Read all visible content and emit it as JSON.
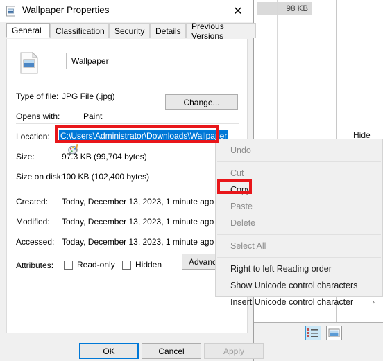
{
  "explorer": {
    "size_cell_value": "98 KB",
    "hide_label": "Hide",
    "view_details_icon": "details-view-icon",
    "view_icons_icon": "large-icons-view-icon"
  },
  "dialog": {
    "title": "Wallpaper Properties",
    "title_icon": "image-file-icon",
    "close_icon": "✕",
    "tabs": [
      {
        "label": "General",
        "active": true
      },
      {
        "label": "Classification",
        "active": false
      },
      {
        "label": "Security",
        "active": false
      },
      {
        "label": "Details",
        "active": false
      },
      {
        "label": "Previous Versions",
        "active": false
      }
    ],
    "file_icon": "image-document-icon",
    "name_value": "Wallpaper",
    "fields": {
      "type_label": "Type of file:",
      "type_value": "JPG File (.jpg)",
      "opens_label": "Opens with:",
      "opens_value": "Paint",
      "opens_icon": "paint-palette-icon",
      "change_button": "Change...",
      "location_label": "Location:",
      "location_value": "C:\\Users\\Administrator\\Downloads\\Wallpaper",
      "size_label": "Size:",
      "size_value": "97.3 KB (99,704 bytes)",
      "size_disk_label": "Size on disk:",
      "size_disk_value": "100 KB (102,400 bytes)",
      "created_label": "Created:",
      "created_value": "Today, December 13, 2023, 1 minute ago",
      "modified_label": "Modified:",
      "modified_value": "Today, December 13, 2023, 1 minute ago",
      "accessed_label": "Accessed:",
      "accessed_value": "Today, December 13, 2023, 1 minute ago",
      "attributes_label": "Attributes:",
      "readonly_label": "Read-only",
      "hidden_label": "Hidden",
      "advanced_button": "Advanced..."
    },
    "buttons": {
      "ok": "OK",
      "cancel": "Cancel",
      "apply": "Apply"
    }
  },
  "context_menu": {
    "items": [
      {
        "label": "Undo",
        "disabled": true
      },
      {
        "label": "Cut",
        "disabled": true
      },
      {
        "label": "Copy",
        "disabled": false
      },
      {
        "label": "Paste",
        "disabled": true
      },
      {
        "label": "Delete",
        "disabled": true
      },
      {
        "label": "Select All",
        "disabled": true
      },
      {
        "label": "Right to left Reading order",
        "disabled": false
      },
      {
        "label": "Show Unicode control characters",
        "disabled": false
      },
      {
        "label": "Insert Unicode control character",
        "disabled": false,
        "submenu": "›"
      }
    ]
  },
  "annotations": {
    "location_highlight_color": "#e8161a",
    "copy_highlight_color": "#e8161a",
    "selection_color": "#0078d7"
  }
}
